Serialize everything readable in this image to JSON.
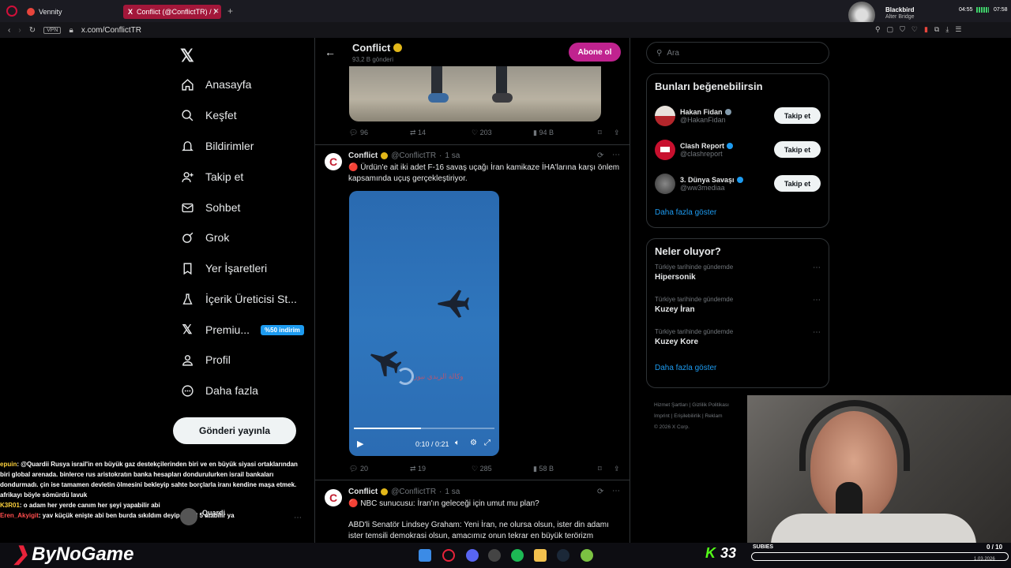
{
  "browser": {
    "tabs": [
      {
        "label": "Vennity"
      },
      {
        "label": "Conflict (@ConflictTR) / X"
      }
    ],
    "url": "x.com/ConflictTR",
    "vpn": "VPN",
    "media_title": "Blackbird",
    "media_artist": "Alter Bridge",
    "clock_left": "04:55",
    "clock_right": "07:58"
  },
  "nav": {
    "items": [
      {
        "label": "Anasayfa"
      },
      {
        "label": "Keşfet"
      },
      {
        "label": "Bildirimler"
      },
      {
        "label": "Takip et"
      },
      {
        "label": "Sohbet"
      },
      {
        "label": "Grok"
      },
      {
        "label": "Yer İşaretleri"
      },
      {
        "label": "İçerik Üreticisi St..."
      },
      {
        "label": "Premiu..."
      },
      {
        "label": "Profil"
      },
      {
        "label": "Daha fazla"
      }
    ],
    "premium_badge": "%50 indirim",
    "post_button": "Gönderi yayınla"
  },
  "profile_header": {
    "name": "Conflict",
    "posts": "93,2 B gönderi",
    "subscribe": "Abone ol"
  },
  "tweet0_actions": {
    "reply": "96",
    "retweet": "14",
    "like": "203",
    "views": "94 B"
  },
  "tweet1": {
    "name": "Conflict",
    "handle": "@ConflictTR",
    "time": "1 sa",
    "text": "🔴 Ürdün'e ait iki adet F-16 savaş uçağı İran kamikaze İHA'larına karşı önlem kapsamında uçuş gerçekleştiriyor.",
    "video_time": "0:10 / 0:21",
    "watermark": "وكالة الزيدي نيوز",
    "actions": {
      "reply": "20",
      "retweet": "19",
      "like": "285",
      "views": "58 B"
    }
  },
  "tweet2": {
    "name": "Conflict",
    "handle": "@ConflictTR",
    "time": "1 sa",
    "line1": "🔴 NBC sunucusu: İran'ın geleceği için umut mu plan?",
    "line2": "ABD'li Senatör Lindsey Graham: Yeni İran, ne olursa olsun, ister din adamı ister temsili demokrasi olsun, amacımız onun tekrar en büyük terörizm"
  },
  "search": {
    "placeholder": "Ara"
  },
  "suggestions": {
    "title": "Bunları beğenebilirsin",
    "users": [
      {
        "name": "Hakan Fidan",
        "handle": "@HakanFidan",
        "button": "Takip et"
      },
      {
        "name": "Clash Report",
        "handle": "@clashreport",
        "button": "Takip et"
      },
      {
        "name": "3. Dünya Savaşı",
        "handle": "@ww3mediaa",
        "button": "Takip et"
      }
    ],
    "more": "Daha fazla göster"
  },
  "trends": {
    "title": "Neler oluyor?",
    "items": [
      {
        "context": "Türkiye tarihinde gündemde",
        "name": "Hipersonik"
      },
      {
        "context": "Türkiye tarihinde gündemde",
        "name": "Kuzey İran"
      },
      {
        "context": "Türkiye tarihinde gündemde",
        "name": "Kuzey Kore"
      }
    ],
    "more": "Daha fazla göster"
  },
  "footer": {
    "l1a": "Hizmet Şartları",
    "l1b": "Gizlilik Politikası",
    "l2a": "Imprint",
    "l2b": "Erişilebilirlik",
    "l2c": "Reklam",
    "l3": "© 2026 X Corp."
  },
  "chat": {
    "m1_user": "epuin",
    "m1_text": ": @Quardii Rusya israil'in en büyük gaz destekçilerinden biri ve en büyük siyasi ortaklarından biri global arenada. binlerce rus aristokratın banka hesapları dondurulurken israil bankaları dondurmadı. çin ise tamamen devletin ölmesini bekleyip sahte borçlarla iranı kendine maşa etmek. afrikayı böyle sömürdü lavuk",
    "m2_user": "K3R01",
    "m2_text": ": o adam her yerde canım her şeyi yapabilir abi",
    "m3_user": "Eren_Akyigit",
    "m3_text": ": yav küçük enişte abi ben burda sıkıldım deyip bile 3 5 atabilir ya",
    "overlay_user": "Quardi"
  },
  "stream": {
    "logo": "ByNoGame",
    "kick_count": "33",
    "subs_label": "SUBIES",
    "subs_count": "0 / 10",
    "date": "1.03.2026"
  },
  "colors": {
    "accent": "#1d9bf0",
    "subscribe": "#c0238f",
    "badge": "#1d9bf0",
    "verified_gold": "#e2b719"
  }
}
